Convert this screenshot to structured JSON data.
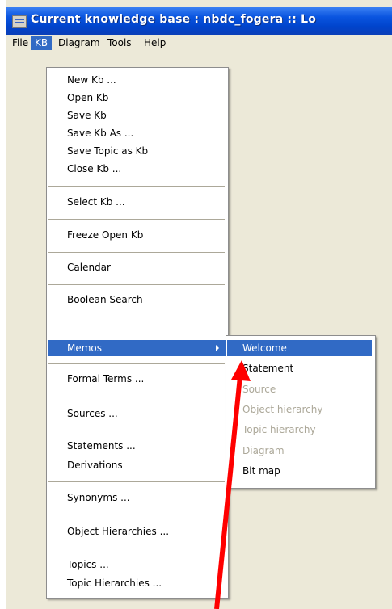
{
  "window": {
    "title": "Current knowledge base : nbdc_fogera  ::  Lo"
  },
  "menubar": {
    "items": [
      "File",
      "KB",
      "Diagram",
      "Tools",
      "Help"
    ]
  },
  "kb_menu": {
    "items": [
      "New Kb ...",
      "Open Kb",
      "Save Kb",
      "Save Kb As ...",
      "Save Topic as Kb",
      "Close Kb ...",
      "Select Kb ...",
      "Freeze Open Kb",
      "Calendar",
      "Boolean Search",
      "Memos",
      "Formal Terms ...",
      "Sources ...",
      "Statements ...",
      "Derivations",
      "Synonyms ...",
      "Object Hierarchies ...",
      "Topics ...",
      "Topic Hierarchies ..."
    ]
  },
  "memos_submenu": {
    "items": [
      "Welcome",
      "Statement",
      "Source",
      "Object hierarchy",
      "Topic hierarchy",
      "Diagram",
      "Bit map"
    ],
    "disabled": [
      "Source",
      "Object hierarchy",
      "Topic hierarchy",
      "Diagram"
    ]
  },
  "colors": {
    "highlight": "#316ac5",
    "annotation_arrow": "#ff0000",
    "titlebar": "#0a55e0"
  }
}
